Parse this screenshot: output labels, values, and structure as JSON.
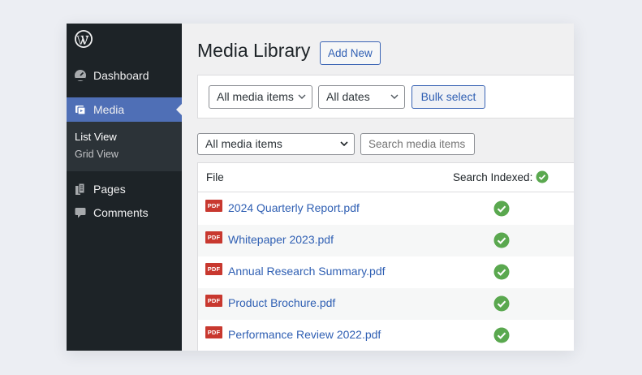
{
  "sidebar": {
    "items": [
      {
        "label": "Dashboard",
        "icon": "dashboard-icon"
      },
      {
        "label": "Media",
        "icon": "media-icon",
        "active": true
      },
      {
        "label": "Pages",
        "icon": "pages-icon"
      },
      {
        "label": "Comments",
        "icon": "comments-icon"
      }
    ],
    "submenu": [
      {
        "label": "List View",
        "active": true
      },
      {
        "label": "Grid View"
      }
    ]
  },
  "header": {
    "title": "Media Library",
    "add_new_label": "Add New"
  },
  "filters": {
    "type_select": "All media items",
    "date_select": "All dates",
    "bulk_select_label": "Bulk select"
  },
  "search_bar": {
    "type_select": "All media items",
    "search_placeholder": "Search media items"
  },
  "table": {
    "columns": [
      "File",
      "Search Indexed:"
    ],
    "rows": [
      {
        "type": "PDF",
        "file": "2024 Quarterly Report.pdf",
        "indexed": true
      },
      {
        "type": "PDF",
        "file": "Whitepaper 2023.pdf",
        "indexed": true
      },
      {
        "type": "PDF",
        "file": "Annual Research Summary.pdf",
        "indexed": true
      },
      {
        "type": "PDF",
        "file": "Product Brochure.pdf",
        "indexed": true
      },
      {
        "type": "PDF",
        "file": "Performance Review 2022.pdf",
        "indexed": true
      }
    ]
  },
  "colors": {
    "sidebar_bg": "#1d2327",
    "menu_active": "#4f6fb6",
    "link": "#2f5fb3",
    "check_green": "#5aa84f",
    "pdf_red": "#c8382f"
  }
}
